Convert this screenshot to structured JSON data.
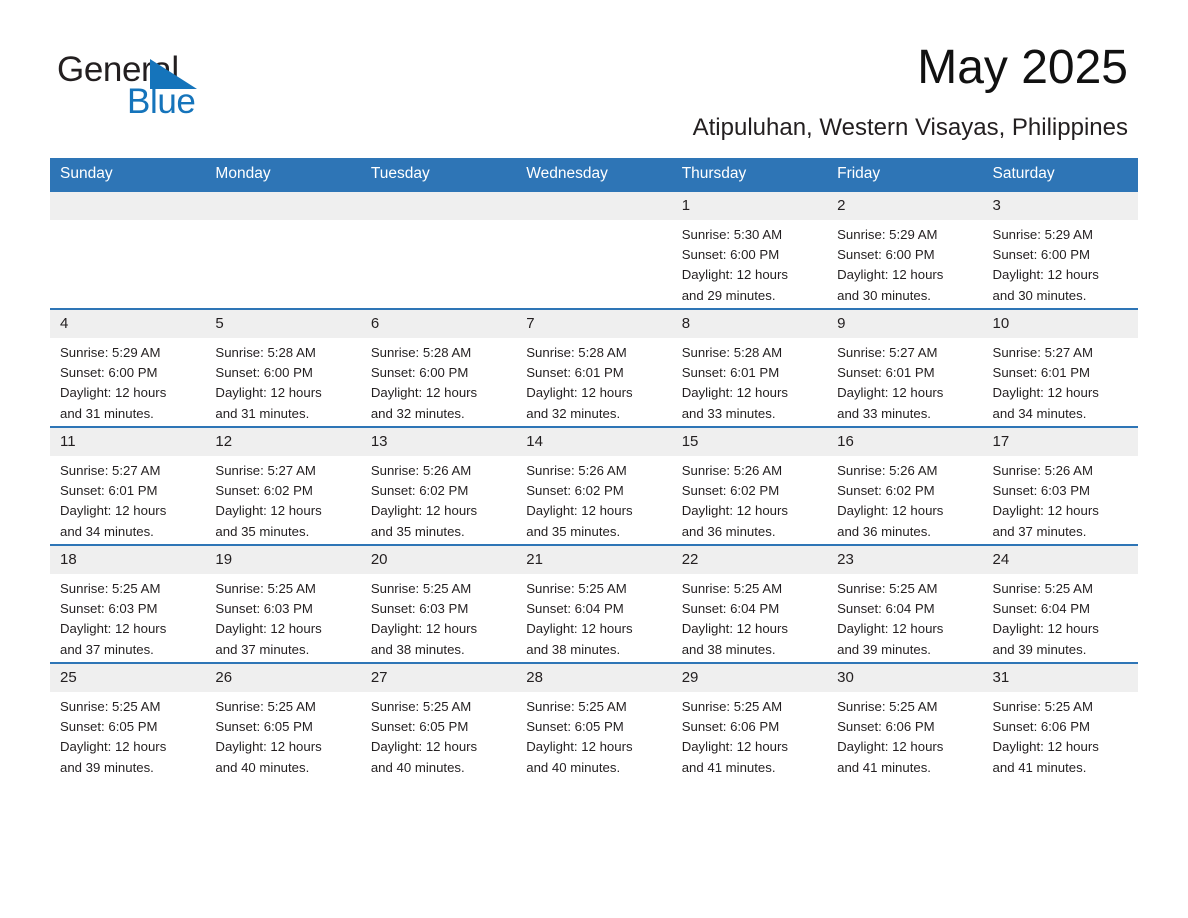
{
  "brand": {
    "name_part1": "General",
    "name_part2": "Blue",
    "accent_color": "#1574bb"
  },
  "header": {
    "title": "May 2025",
    "location": "Atipuluhan, Western Visayas, Philippines",
    "header_bg": "#2e75b6",
    "daynum_bg": "#efefef"
  },
  "weekdays": [
    "Sunday",
    "Monday",
    "Tuesday",
    "Wednesday",
    "Thursday",
    "Friday",
    "Saturday"
  ],
  "weeks": [
    [
      {
        "day": "",
        "sunrise": "",
        "sunset": "",
        "daylight1": "",
        "daylight2": ""
      },
      {
        "day": "",
        "sunrise": "",
        "sunset": "",
        "daylight1": "",
        "daylight2": ""
      },
      {
        "day": "",
        "sunrise": "",
        "sunset": "",
        "daylight1": "",
        "daylight2": ""
      },
      {
        "day": "",
        "sunrise": "",
        "sunset": "",
        "daylight1": "",
        "daylight2": ""
      },
      {
        "day": "1",
        "sunrise": "Sunrise: 5:30 AM",
        "sunset": "Sunset: 6:00 PM",
        "daylight1": "Daylight: 12 hours",
        "daylight2": "and 29 minutes."
      },
      {
        "day": "2",
        "sunrise": "Sunrise: 5:29 AM",
        "sunset": "Sunset: 6:00 PM",
        "daylight1": "Daylight: 12 hours",
        "daylight2": "and 30 minutes."
      },
      {
        "day": "3",
        "sunrise": "Sunrise: 5:29 AM",
        "sunset": "Sunset: 6:00 PM",
        "daylight1": "Daylight: 12 hours",
        "daylight2": "and 30 minutes."
      }
    ],
    [
      {
        "day": "4",
        "sunrise": "Sunrise: 5:29 AM",
        "sunset": "Sunset: 6:00 PM",
        "daylight1": "Daylight: 12 hours",
        "daylight2": "and 31 minutes."
      },
      {
        "day": "5",
        "sunrise": "Sunrise: 5:28 AM",
        "sunset": "Sunset: 6:00 PM",
        "daylight1": "Daylight: 12 hours",
        "daylight2": "and 31 minutes."
      },
      {
        "day": "6",
        "sunrise": "Sunrise: 5:28 AM",
        "sunset": "Sunset: 6:00 PM",
        "daylight1": "Daylight: 12 hours",
        "daylight2": "and 32 minutes."
      },
      {
        "day": "7",
        "sunrise": "Sunrise: 5:28 AM",
        "sunset": "Sunset: 6:01 PM",
        "daylight1": "Daylight: 12 hours",
        "daylight2": "and 32 minutes."
      },
      {
        "day": "8",
        "sunrise": "Sunrise: 5:28 AM",
        "sunset": "Sunset: 6:01 PM",
        "daylight1": "Daylight: 12 hours",
        "daylight2": "and 33 minutes."
      },
      {
        "day": "9",
        "sunrise": "Sunrise: 5:27 AM",
        "sunset": "Sunset: 6:01 PM",
        "daylight1": "Daylight: 12 hours",
        "daylight2": "and 33 minutes."
      },
      {
        "day": "10",
        "sunrise": "Sunrise: 5:27 AM",
        "sunset": "Sunset: 6:01 PM",
        "daylight1": "Daylight: 12 hours",
        "daylight2": "and 34 minutes."
      }
    ],
    [
      {
        "day": "11",
        "sunrise": "Sunrise: 5:27 AM",
        "sunset": "Sunset: 6:01 PM",
        "daylight1": "Daylight: 12 hours",
        "daylight2": "and 34 minutes."
      },
      {
        "day": "12",
        "sunrise": "Sunrise: 5:27 AM",
        "sunset": "Sunset: 6:02 PM",
        "daylight1": "Daylight: 12 hours",
        "daylight2": "and 35 minutes."
      },
      {
        "day": "13",
        "sunrise": "Sunrise: 5:26 AM",
        "sunset": "Sunset: 6:02 PM",
        "daylight1": "Daylight: 12 hours",
        "daylight2": "and 35 minutes."
      },
      {
        "day": "14",
        "sunrise": "Sunrise: 5:26 AM",
        "sunset": "Sunset: 6:02 PM",
        "daylight1": "Daylight: 12 hours",
        "daylight2": "and 35 minutes."
      },
      {
        "day": "15",
        "sunrise": "Sunrise: 5:26 AM",
        "sunset": "Sunset: 6:02 PM",
        "daylight1": "Daylight: 12 hours",
        "daylight2": "and 36 minutes."
      },
      {
        "day": "16",
        "sunrise": "Sunrise: 5:26 AM",
        "sunset": "Sunset: 6:02 PM",
        "daylight1": "Daylight: 12 hours",
        "daylight2": "and 36 minutes."
      },
      {
        "day": "17",
        "sunrise": "Sunrise: 5:26 AM",
        "sunset": "Sunset: 6:03 PM",
        "daylight1": "Daylight: 12 hours",
        "daylight2": "and 37 minutes."
      }
    ],
    [
      {
        "day": "18",
        "sunrise": "Sunrise: 5:25 AM",
        "sunset": "Sunset: 6:03 PM",
        "daylight1": "Daylight: 12 hours",
        "daylight2": "and 37 minutes."
      },
      {
        "day": "19",
        "sunrise": "Sunrise: 5:25 AM",
        "sunset": "Sunset: 6:03 PM",
        "daylight1": "Daylight: 12 hours",
        "daylight2": "and 37 minutes."
      },
      {
        "day": "20",
        "sunrise": "Sunrise: 5:25 AM",
        "sunset": "Sunset: 6:03 PM",
        "daylight1": "Daylight: 12 hours",
        "daylight2": "and 38 minutes."
      },
      {
        "day": "21",
        "sunrise": "Sunrise: 5:25 AM",
        "sunset": "Sunset: 6:04 PM",
        "daylight1": "Daylight: 12 hours",
        "daylight2": "and 38 minutes."
      },
      {
        "day": "22",
        "sunrise": "Sunrise: 5:25 AM",
        "sunset": "Sunset: 6:04 PM",
        "daylight1": "Daylight: 12 hours",
        "daylight2": "and 38 minutes."
      },
      {
        "day": "23",
        "sunrise": "Sunrise: 5:25 AM",
        "sunset": "Sunset: 6:04 PM",
        "daylight1": "Daylight: 12 hours",
        "daylight2": "and 39 minutes."
      },
      {
        "day": "24",
        "sunrise": "Sunrise: 5:25 AM",
        "sunset": "Sunset: 6:04 PM",
        "daylight1": "Daylight: 12 hours",
        "daylight2": "and 39 minutes."
      }
    ],
    [
      {
        "day": "25",
        "sunrise": "Sunrise: 5:25 AM",
        "sunset": "Sunset: 6:05 PM",
        "daylight1": "Daylight: 12 hours",
        "daylight2": "and 39 minutes."
      },
      {
        "day": "26",
        "sunrise": "Sunrise: 5:25 AM",
        "sunset": "Sunset: 6:05 PM",
        "daylight1": "Daylight: 12 hours",
        "daylight2": "and 40 minutes."
      },
      {
        "day": "27",
        "sunrise": "Sunrise: 5:25 AM",
        "sunset": "Sunset: 6:05 PM",
        "daylight1": "Daylight: 12 hours",
        "daylight2": "and 40 minutes."
      },
      {
        "day": "28",
        "sunrise": "Sunrise: 5:25 AM",
        "sunset": "Sunset: 6:05 PM",
        "daylight1": "Daylight: 12 hours",
        "daylight2": "and 40 minutes."
      },
      {
        "day": "29",
        "sunrise": "Sunrise: 5:25 AM",
        "sunset": "Sunset: 6:06 PM",
        "daylight1": "Daylight: 12 hours",
        "daylight2": "and 41 minutes."
      },
      {
        "day": "30",
        "sunrise": "Sunrise: 5:25 AM",
        "sunset": "Sunset: 6:06 PM",
        "daylight1": "Daylight: 12 hours",
        "daylight2": "and 41 minutes."
      },
      {
        "day": "31",
        "sunrise": "Sunrise: 5:25 AM",
        "sunset": "Sunset: 6:06 PM",
        "daylight1": "Daylight: 12 hours",
        "daylight2": "and 41 minutes."
      }
    ]
  ]
}
